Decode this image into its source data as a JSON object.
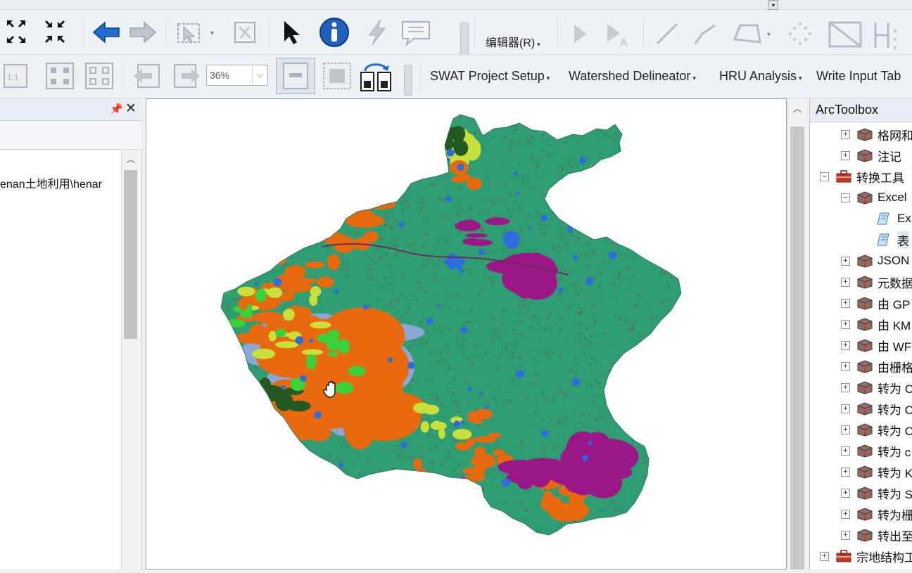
{
  "toolbar2": {
    "editor_label": "编辑器(R)"
  },
  "toolbar3": {
    "zoom_value": "36%",
    "menus": [
      {
        "label": "SWAT Project Setup"
      },
      {
        "label": "Watershed Delineator"
      },
      {
        "label": "HRU Analysis"
      },
      {
        "label": "Write Input Tab"
      }
    ]
  },
  "left_panel": {
    "path_text": "enan土地利用\\henar"
  },
  "toolbox": {
    "title": "ArcToolbox",
    "items": [
      {
        "label": "格网和",
        "expander": "+",
        "kind": "toolset",
        "indent": 0
      },
      {
        "label": "注记",
        "expander": "+",
        "kind": "toolset",
        "indent": 0
      },
      {
        "label": "转换工具",
        "expander": "−",
        "kind": "toolbox",
        "indent": -1
      },
      {
        "label": "Excel",
        "expander": "−",
        "kind": "toolset",
        "indent": 0
      },
      {
        "label": "Ex",
        "expander": "",
        "kind": "script",
        "indent": 1
      },
      {
        "label": "表",
        "expander": "",
        "kind": "script",
        "indent": 1
      },
      {
        "label": "JSON",
        "expander": "+",
        "kind": "toolset",
        "indent": 0
      },
      {
        "label": "元数据",
        "expander": "+",
        "kind": "toolset",
        "indent": 0
      },
      {
        "label": "由 GP",
        "expander": "+",
        "kind": "toolset",
        "indent": 0
      },
      {
        "label": "由 KM",
        "expander": "+",
        "kind": "toolset",
        "indent": 0
      },
      {
        "label": "由 WF",
        "expander": "+",
        "kind": "toolset",
        "indent": 0
      },
      {
        "label": "由栅格",
        "expander": "+",
        "kind": "toolset",
        "indent": 0
      },
      {
        "label": "转为 C",
        "expander": "+",
        "kind": "toolset",
        "indent": 0
      },
      {
        "label": "转为 C",
        "expander": "+",
        "kind": "toolset",
        "indent": 0
      },
      {
        "label": "转为 C",
        "expander": "+",
        "kind": "toolset",
        "indent": 0
      },
      {
        "label": "转为 c",
        "expander": "+",
        "kind": "toolset",
        "indent": 0
      },
      {
        "label": "转为 K",
        "expander": "+",
        "kind": "toolset",
        "indent": 0
      },
      {
        "label": "转为 S",
        "expander": "+",
        "kind": "toolset",
        "indent": 0
      },
      {
        "label": "转为栅",
        "expander": "+",
        "kind": "toolset",
        "indent": 0
      },
      {
        "label": "转出至",
        "expander": "+",
        "kind": "toolset",
        "indent": 0
      },
      {
        "label": "宗地结构工",
        "expander": "+",
        "kind": "toolbox",
        "indent": -1
      }
    ]
  },
  "map": {
    "legend_colors": {
      "cropland": "#2e9e72",
      "forest": "#e8690e",
      "grassland": "#8aa7d6",
      "water": "#2c6be0",
      "urban": "#9a1785",
      "shrub": "#c9e03a",
      "dark_forest": "#245a21",
      "bright_green": "#3ad13a"
    }
  },
  "colors": {
    "toolbar_bg": "#eef1f6",
    "accent_blue": "#1f6fd1"
  }
}
